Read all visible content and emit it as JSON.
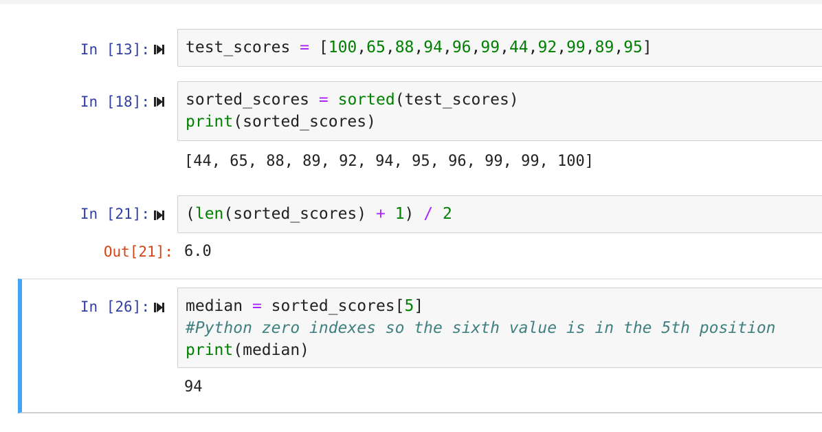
{
  "cells": [
    {
      "prompt": "In [13]:",
      "tokens": [
        [
          {
            "t": "test_scores ",
            "c": "pn"
          },
          {
            "t": "=",
            "c": "op"
          },
          {
            "t": " [",
            "c": "pn"
          },
          {
            "t": "100",
            "c": "num"
          },
          {
            "t": ",",
            "c": "pn"
          },
          {
            "t": "65",
            "c": "num"
          },
          {
            "t": ",",
            "c": "pn"
          },
          {
            "t": "88",
            "c": "num"
          },
          {
            "t": ",",
            "c": "pn"
          },
          {
            "t": "94",
            "c": "num"
          },
          {
            "t": ",",
            "c": "pn"
          },
          {
            "t": "96",
            "c": "num"
          },
          {
            "t": ",",
            "c": "pn"
          },
          {
            "t": "99",
            "c": "num"
          },
          {
            "t": ",",
            "c": "pn"
          },
          {
            "t": "44",
            "c": "num"
          },
          {
            "t": ",",
            "c": "pn"
          },
          {
            "t": "92",
            "c": "num"
          },
          {
            "t": ",",
            "c": "pn"
          },
          {
            "t": "99",
            "c": "num"
          },
          {
            "t": ",",
            "c": "pn"
          },
          {
            "t": "89",
            "c": "num"
          },
          {
            "t": ",",
            "c": "pn"
          },
          {
            "t": "95",
            "c": "num"
          },
          {
            "t": "]",
            "c": "pn"
          }
        ]
      ]
    },
    {
      "prompt": "In [18]:",
      "tokens": [
        [
          {
            "t": "sorted_scores ",
            "c": "pn"
          },
          {
            "t": "=",
            "c": "op"
          },
          {
            "t": " ",
            "c": "pn"
          },
          {
            "t": "sorted",
            "c": "bi"
          },
          {
            "t": "(test_scores)",
            "c": "pn"
          }
        ],
        [
          {
            "t": "print",
            "c": "bi"
          },
          {
            "t": "(sorted_scores)",
            "c": "pn"
          }
        ]
      ],
      "stdout": "[44, 65, 88, 89, 92, 94, 95, 96, 99, 99, 100]"
    },
    {
      "prompt": "In [21]:",
      "tokens": [
        [
          {
            "t": "(",
            "c": "pn"
          },
          {
            "t": "len",
            "c": "bi"
          },
          {
            "t": "(sorted_scores) ",
            "c": "pn"
          },
          {
            "t": "+",
            "c": "op"
          },
          {
            "t": " ",
            "c": "pn"
          },
          {
            "t": "1",
            "c": "num"
          },
          {
            "t": ") ",
            "c": "pn"
          },
          {
            "t": "/",
            "c": "op"
          },
          {
            "t": " ",
            "c": "pn"
          },
          {
            "t": "2",
            "c": "num"
          }
        ]
      ],
      "out_prompt": "Out[21]:",
      "result": "6.0"
    },
    {
      "prompt": "In [26]:",
      "tokens": [
        [
          {
            "t": "median ",
            "c": "pn"
          },
          {
            "t": "=",
            "c": "op"
          },
          {
            "t": " sorted_scores[",
            "c": "pn"
          },
          {
            "t": "5",
            "c": "num"
          },
          {
            "t": "]",
            "c": "pn"
          }
        ],
        [
          {
            "t": "#Python zero indexes so the sixth value is in the 5th position",
            "c": "cm"
          }
        ],
        [
          {
            "t": "print",
            "c": "bi"
          },
          {
            "t": "(median)",
            "c": "pn"
          }
        ]
      ],
      "stdout": "94"
    }
  ],
  "colors": {
    "input_prompt": "#303f9f",
    "output_prompt": "#d84315",
    "selected_cell_bar": "#42a5f5"
  },
  "icons": {
    "run": "run-cell-icon"
  }
}
